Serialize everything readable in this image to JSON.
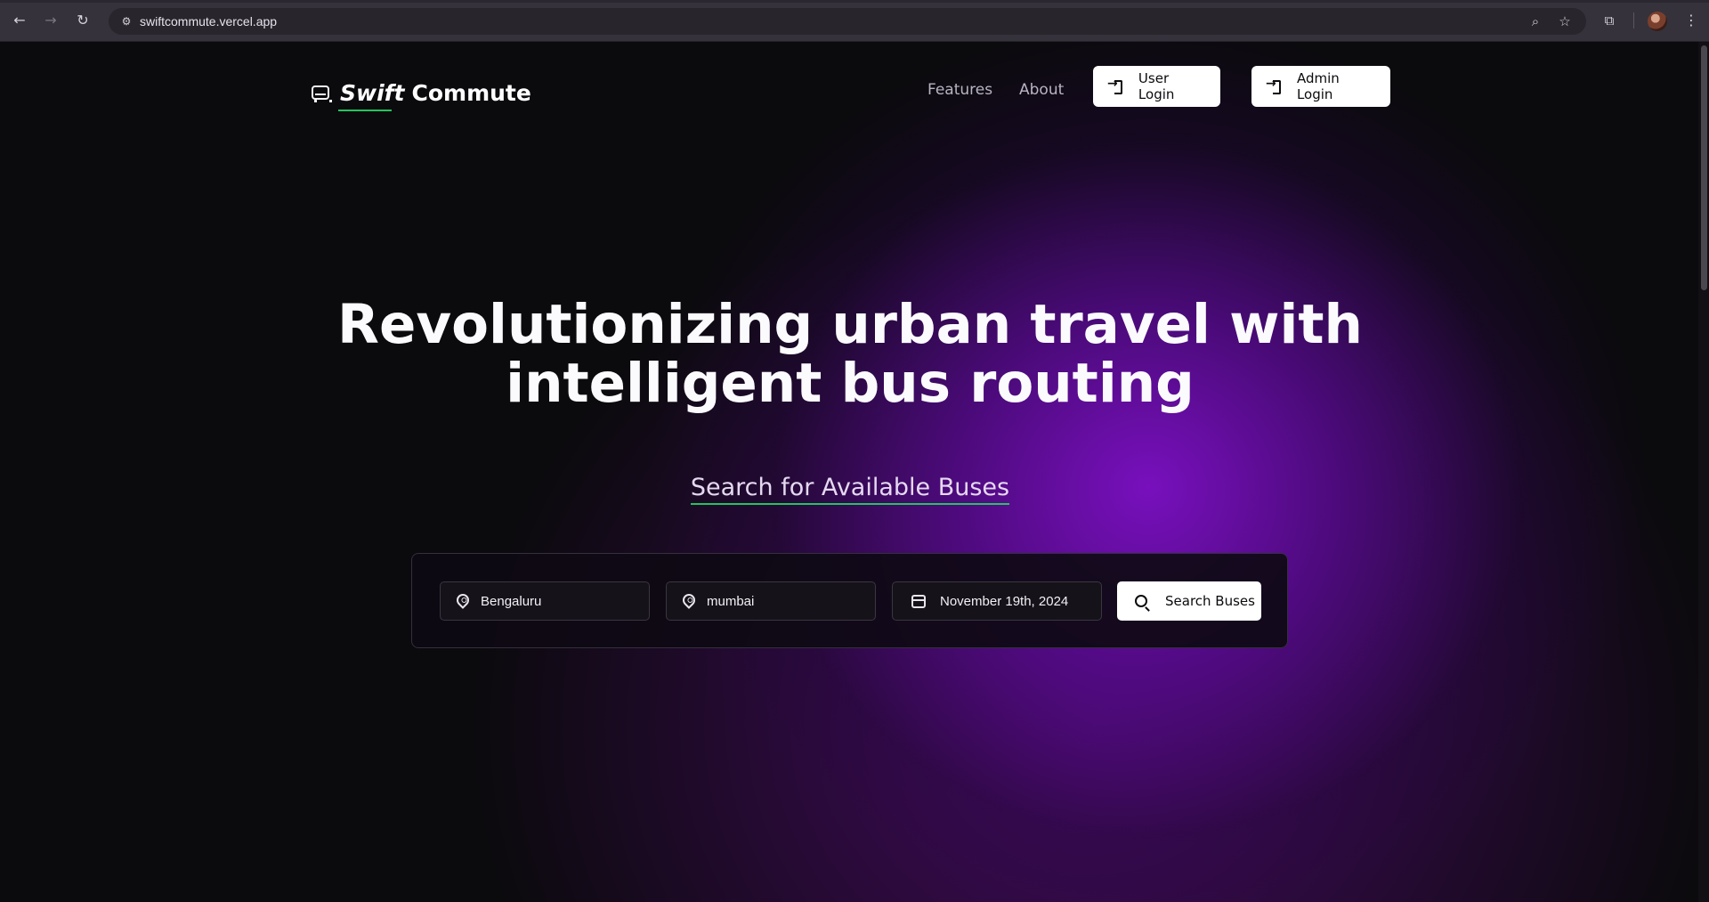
{
  "browser": {
    "url": "swiftcommute.vercel.app",
    "back_icon": "←",
    "forward_icon": "→",
    "reload_icon": "↻",
    "site_info_icon": "⚙",
    "zoom_icon": "⌕",
    "star_icon": "☆",
    "extensions_icon": "⧉",
    "menu_icon": "⋮"
  },
  "header": {
    "brand_swift": "Swift",
    "brand_commute": "Commute",
    "nav": {
      "features": "Features",
      "about": "About"
    },
    "user_login": "User Login",
    "admin_login": "Admin Login"
  },
  "hero": {
    "title_line1": "Revolutionizing urban travel with",
    "title_line2": "intelligent bus routing",
    "subheading": "Search for Available Buses"
  },
  "search": {
    "from_value": "Bengaluru",
    "to_value": "mumbai",
    "date_value": "November 19th, 2024",
    "button_label": "Search Buses"
  },
  "colors": {
    "accent_green": "#22c55e",
    "glow_purple": "#7c10c4",
    "background": "#0b0a0d"
  }
}
